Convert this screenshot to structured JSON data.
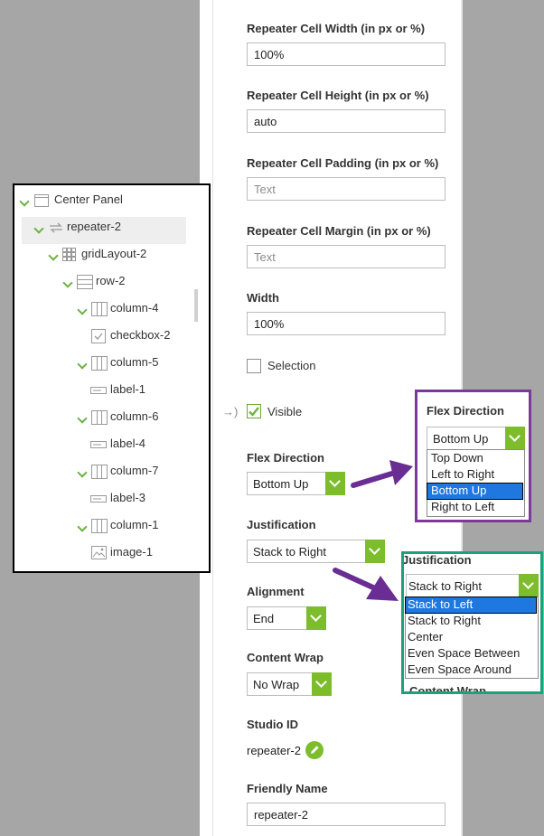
{
  "properties": {
    "repeater_cell_width": {
      "label": "Repeater Cell Width (in px or %)",
      "value": "100%"
    },
    "repeater_cell_height": {
      "label": "Repeater Cell Height (in px or %)",
      "value": "auto"
    },
    "repeater_cell_padding": {
      "label": "Repeater Cell Padding (in px or %)",
      "placeholder": "Text"
    },
    "repeater_cell_margin": {
      "label": "Repeater Cell Margin (in px or %)",
      "placeholder": "Text"
    },
    "width": {
      "label": "Width",
      "value": "100%"
    },
    "selection": {
      "label": "Selection",
      "checked": false
    },
    "visible": {
      "label": "Visible",
      "checked": true,
      "marker": "→)"
    },
    "flex_direction": {
      "label": "Flex Direction",
      "value": "Bottom Up"
    },
    "justification": {
      "label": "Justification",
      "value": "Stack to Right"
    },
    "alignment": {
      "label": "Alignment",
      "value": "End"
    },
    "content_wrap": {
      "label": "Content Wrap",
      "value": "No Wrap"
    },
    "studio_id": {
      "label": "Studio ID",
      "value": "repeater-2"
    },
    "friendly_name": {
      "label": "Friendly Name",
      "value": "repeater-2"
    }
  },
  "tree": {
    "items": [
      {
        "label": "Center Panel",
        "icon": "panel-icon"
      },
      {
        "label": "repeater-2",
        "icon": "repeater-icon",
        "selected": true
      },
      {
        "label": "gridLayout-2",
        "icon": "grid-icon"
      },
      {
        "label": "row-2",
        "icon": "row-icon"
      },
      {
        "label": "column-4",
        "icon": "column-icon"
      },
      {
        "label": "checkbox-2",
        "icon": "checkbox-icon"
      },
      {
        "label": "column-5",
        "icon": "column-icon"
      },
      {
        "label": "label-1",
        "icon": "label-icon"
      },
      {
        "label": "column-6",
        "icon": "column-icon"
      },
      {
        "label": "label-4",
        "icon": "label-icon"
      },
      {
        "label": "column-7",
        "icon": "column-icon"
      },
      {
        "label": "label-3",
        "icon": "label-icon"
      },
      {
        "label": "column-1",
        "icon": "column-icon"
      },
      {
        "label": "image-1",
        "icon": "image-icon"
      }
    ]
  },
  "popup_flex": {
    "label": "Flex Direction",
    "value": "Bottom Up",
    "options": [
      "Top Down",
      "Left to Right",
      "Bottom Up",
      "Right to Left"
    ],
    "highlighted": "Bottom Up"
  },
  "popup_just": {
    "label": "Justification",
    "value": "Stack to Right",
    "options": [
      "Stack to Left",
      "Stack to Right",
      "Center",
      "Even Space Between",
      "Even Space Around"
    ],
    "highlighted": "Stack to Left",
    "below_label": "Content Wrap"
  },
  "colors": {
    "accent_green": "#7dbd2c",
    "arrow_purple": "#6a2d93",
    "highlight_blue": "#1e78e0",
    "popup_border_purple": "#7b3a9a",
    "popup_border_teal": "#1aa37a"
  }
}
